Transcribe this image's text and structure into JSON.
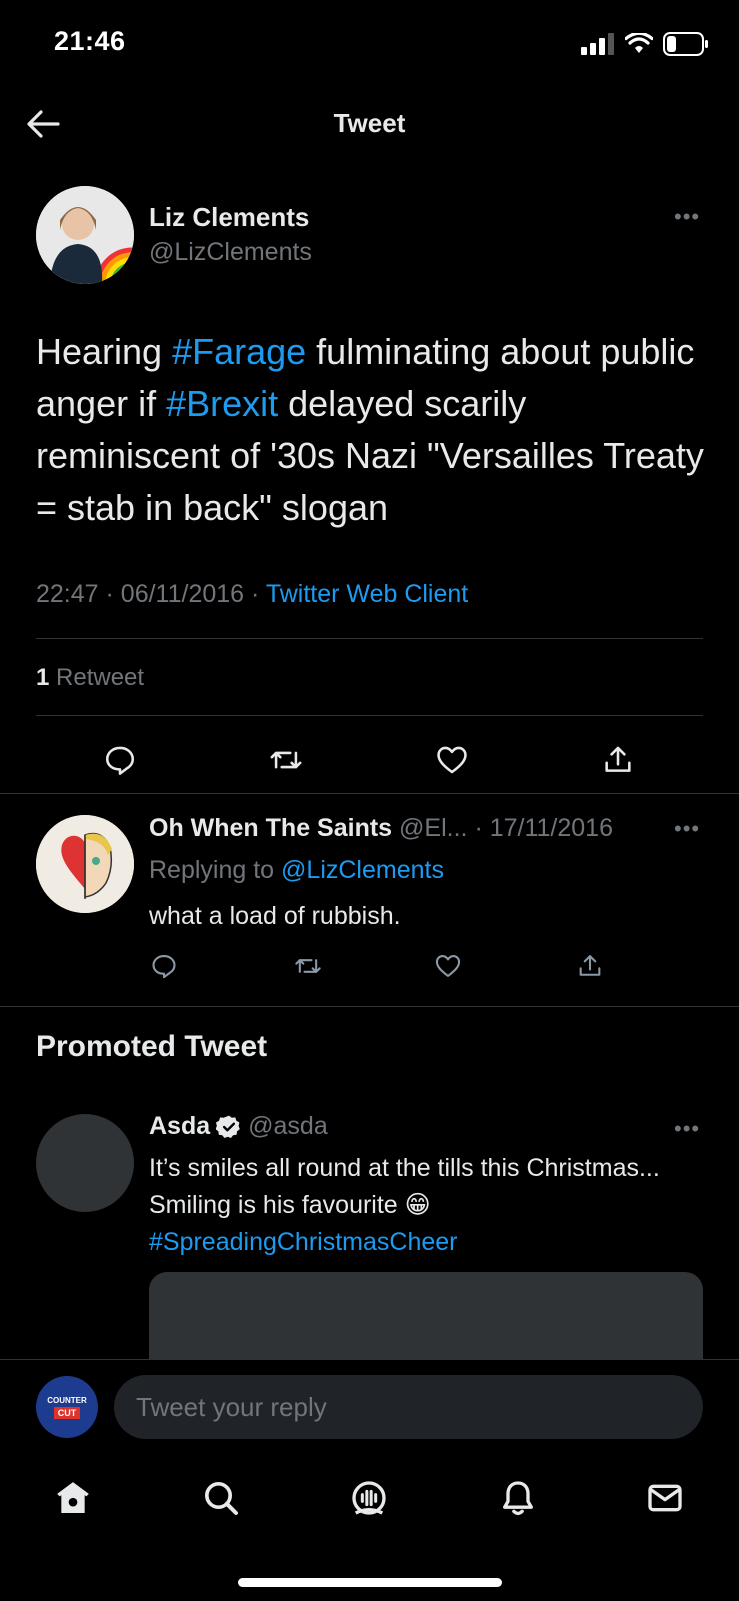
{
  "status_bar": {
    "time": "21:46"
  },
  "header": {
    "title": "Tweet"
  },
  "main_tweet": {
    "author_name": "Liz Clements",
    "author_handle": "@LizClements",
    "text_parts": [
      "Hearing ",
      "#Farage",
      " fulminating about public anger if ",
      "#Brexit",
      " delayed scarily reminiscent of '30s Nazi \"Versailles Treaty = stab in back\" slogan"
    ],
    "time": "22:47",
    "date": "06/11/2016",
    "client": "Twitter Web Client",
    "retweet_count": "1",
    "retweet_label": "Retweet"
  },
  "reply_tweet": {
    "author_name": "Oh When The Saints",
    "author_handle": "@El...",
    "date": "17/11/2016",
    "replying_to_label": "Replying to",
    "replying_to_handle": "@LizClements",
    "text": "what a load of rubbish."
  },
  "promoted": {
    "section_title": "Promoted Tweet",
    "author_name": "Asda",
    "author_handle": "@asda",
    "text": "It’s smiles all round at the tills this Christmas... Smiling is his favourite",
    "emoji": "😁",
    "hashtag": "#SpreadingChristmasCheer"
  },
  "composer": {
    "placeholder": "Tweet your reply",
    "avatar_line1": "COUNTER",
    "avatar_line2": "CUT"
  },
  "separators": {
    "dot": "·",
    "more": "•••"
  },
  "colors": {
    "accent": "#1d9bf0",
    "background": "#000000",
    "muted": "#71767b"
  },
  "icons": [
    "back-arrow-icon",
    "reply-icon",
    "retweet-icon",
    "like-icon",
    "share-icon",
    "home-icon",
    "search-icon",
    "spaces-icon",
    "notifications-icon",
    "messages-icon",
    "verified-badge-icon"
  ]
}
